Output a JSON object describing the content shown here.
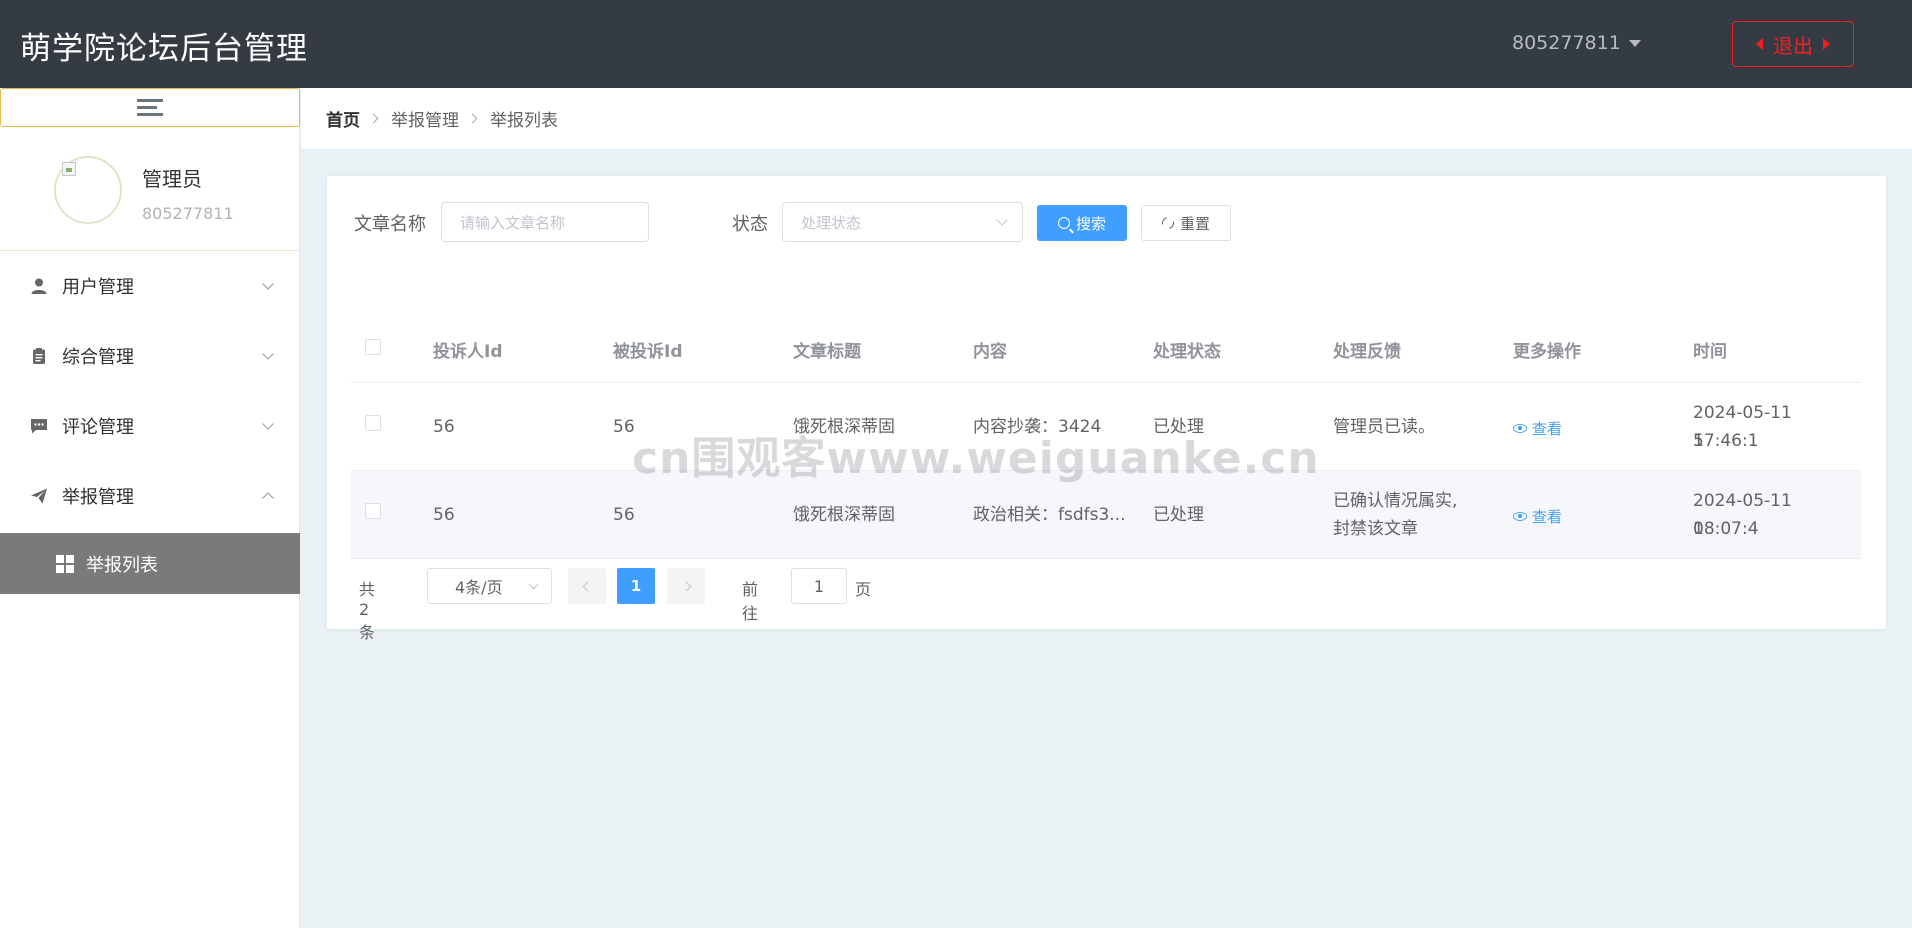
{
  "header": {
    "brand": "萌学院论坛后台管理",
    "username": "805277811",
    "logout_label": "退出"
  },
  "sidebar": {
    "profile": {
      "role": "管理员",
      "id": "805277811"
    },
    "menu": [
      {
        "label": "用户管理",
        "icon": "user-icon",
        "expanded": false
      },
      {
        "label": "综合管理",
        "icon": "clipboard-icon",
        "expanded": false
      },
      {
        "label": "评论管理",
        "icon": "comment-icon",
        "expanded": false
      },
      {
        "label": "举报管理",
        "icon": "send-icon",
        "expanded": true
      }
    ],
    "active_submenu": {
      "label": "举报列表",
      "icon": "grid-icon"
    }
  },
  "breadcrumb": [
    "首页",
    "举报管理",
    "举报列表"
  ],
  "filters": {
    "title_label": "文章名称",
    "title_placeholder": "请输入文章名称",
    "status_label": "状态",
    "status_placeholder": "处理状态",
    "search_label": "搜索",
    "reset_label": "重置"
  },
  "table": {
    "columns": [
      "投诉人Id",
      "被投诉Id",
      "文章标题",
      "内容",
      "处理状态",
      "处理反馈",
      "更多操作",
      "时间"
    ],
    "rows": [
      {
        "reporter_id": "56",
        "reported_id": "56",
        "title": "饿死根深蒂固",
        "content": "内容抄袭：3424",
        "status": "已处理",
        "feedback_1": "管理员已读。",
        "feedback_2": "",
        "action": "查看",
        "time_1": "2024-05-11 17:46:1",
        "time_2": "5"
      },
      {
        "reporter_id": "56",
        "reported_id": "56",
        "title": "饿死根深蒂固",
        "content": "政治相关：fsdfs3...",
        "status": "已处理",
        "feedback_1": "已确认情况属实,",
        "feedback_2": "封禁该文章",
        "action": "查看",
        "time_1": "2024-05-11 18:07:4",
        "time_2": "0"
      }
    ]
  },
  "pagination": {
    "total": "共 2 条",
    "page_size": "4条/页",
    "current_page": "1",
    "goto_label": "前往",
    "goto_value": "1",
    "goto_unit": "页"
  },
  "watermark": "cn围观客www.weiguanke.cn",
  "colors": {
    "header_bg": "#353b43",
    "primary": "#409eff",
    "danger": "#f02020",
    "sidebar_active": "#7a7a7a"
  }
}
